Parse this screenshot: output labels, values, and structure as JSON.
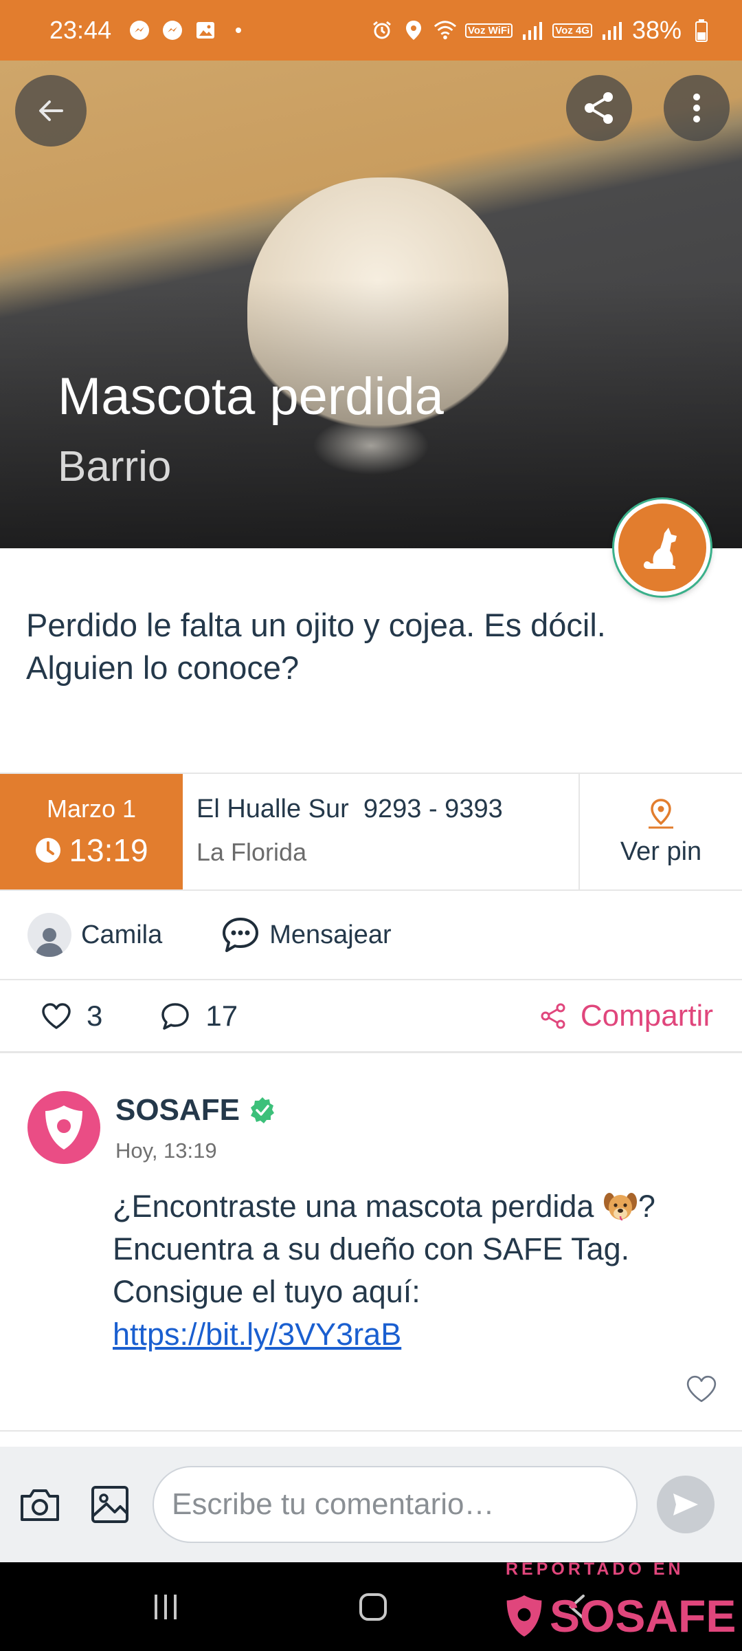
{
  "status_bar": {
    "time": "23:44",
    "signal_label_1": "Voz WiFi",
    "signal_label_2": "Voz 4G",
    "battery": "38%"
  },
  "hero": {
    "title": "Mascota perdida",
    "subtitle": "Barrio",
    "back_icon": "arrow-left-icon",
    "share_icon": "share-icon",
    "more_icon": "more-vertical-icon",
    "badge_icon": "dog-icon"
  },
  "post": {
    "description": "Perdido le falta un ojito y cojea. Es dócil. Alguien lo conoce?"
  },
  "info": {
    "date": "Marzo 1",
    "time": "13:19",
    "street": "El Hualle Sur  9293 - 9393",
    "commune": "La Florida",
    "pin_label": "Ver pin"
  },
  "user": {
    "name": "Camila",
    "message_label": "Mensajear"
  },
  "stats": {
    "likes": "3",
    "comments": "17",
    "share_label": "Compartir"
  },
  "comment": {
    "author": "SOSAFE",
    "time": "Hoy, 13:19",
    "text_part1": "¿Encontraste una mascota perdida ",
    "text_part2": "? Encuentra a su dueño con SAFE Tag. Consigue el tuyo aquí: ",
    "link": "https://bit.ly/3VY3raB"
  },
  "comment_bar": {
    "placeholder": "Escribe tu comentario…"
  },
  "watermark": {
    "top": "REPORTADO EN",
    "brand": "SOSAFE"
  },
  "colors": {
    "accent_orange": "#e27d2e",
    "brand_pink": "#e0467c",
    "verified_green": "#3cc07a",
    "link_blue": "#1a5fd0"
  }
}
